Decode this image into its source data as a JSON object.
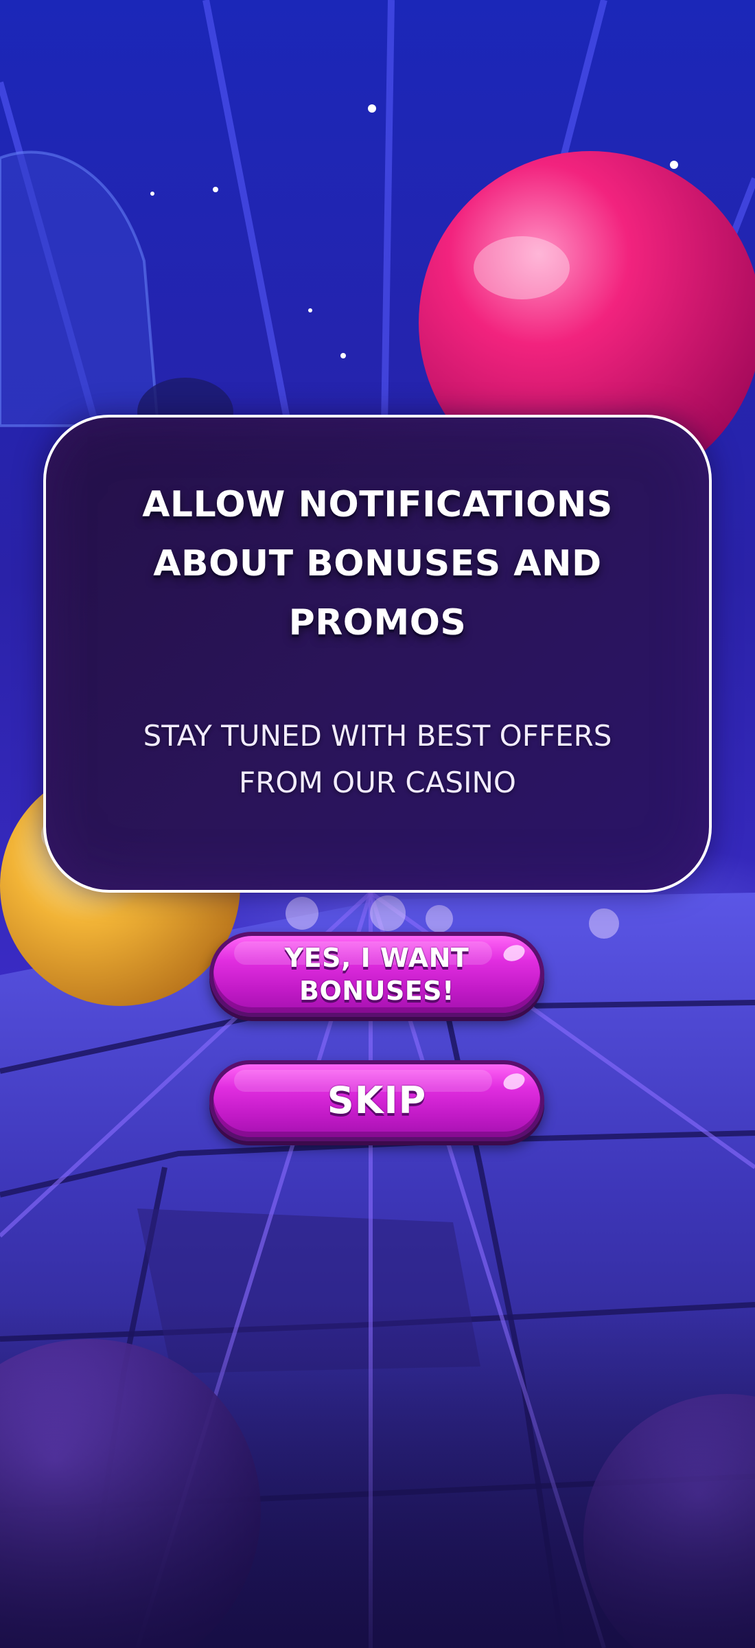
{
  "dialog": {
    "title": "ALLOW NOTIFICATIONS ABOUT BONUSES AND PROMOS",
    "subtitle": "STAY TUNED WITH BEST OFFERS FROM OUR CASINO"
  },
  "buttons": {
    "accept_label": "YES, I WANT BONUSES!",
    "skip_label": "SKIP"
  },
  "colors": {
    "background": "#1a1456",
    "dialog_fill": "#2a1459",
    "dialog_border": "#ffffff",
    "button_fill": "#e12ee0",
    "button_border": "#5a0f6e",
    "pink_sphere": "#f2237e",
    "gold_sphere": "#f2b437"
  },
  "icons": {
    "background": "casino-road-scene-illustration"
  }
}
